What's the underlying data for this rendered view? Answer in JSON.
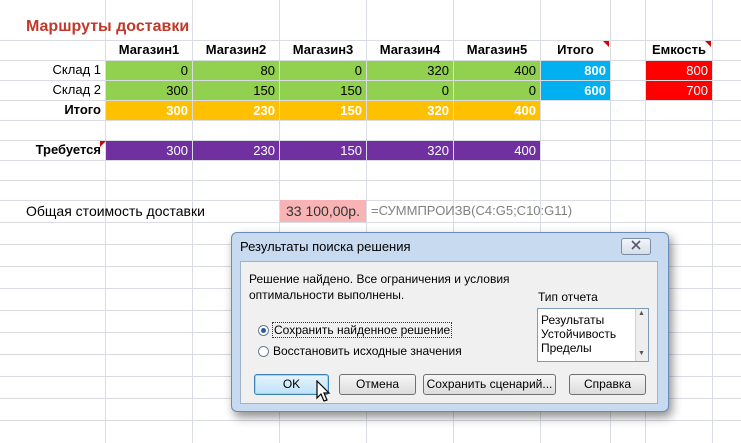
{
  "sheet": {
    "title": "Маршруты доставки",
    "col_headers": [
      "Магазин1",
      "Магазин2",
      "Магазин3",
      "Магазин4",
      "Магазин5"
    ],
    "total_header": "Итого",
    "capacity_header": "Емкость",
    "rows": [
      {
        "label": "Склад 1",
        "values": [
          "0",
          "80",
          "0",
          "320",
          "400"
        ],
        "total": "800",
        "capacity": "800"
      },
      {
        "label": "Склад 2",
        "values": [
          "300",
          "150",
          "150",
          "0",
          "0"
        ],
        "total": "600",
        "capacity": "700"
      }
    ],
    "totals_row": {
      "label": "Итого",
      "values": [
        "300",
        "230",
        "150",
        "320",
        "400"
      ]
    },
    "required_row": {
      "label": "Требуется",
      "values": [
        "300",
        "230",
        "150",
        "320",
        "400"
      ]
    },
    "cost_label": "Общая стоимость доставки",
    "cost_value": "33 100,00р.",
    "cost_formula": "=СУММПРОИЗВ(C4:G5;C10:G11)"
  },
  "colors": {
    "green": "#92d050",
    "orange": "#ffc000",
    "purple": "#7030a0",
    "blue": "#00b0f0",
    "red": "#ff0000",
    "pink": "#f8b4b4",
    "title": "#c0392b"
  },
  "dialog": {
    "title": "Результаты поиска решения",
    "close_icon": "close-icon",
    "message_line1": "Решение найдено. Все ограничения и условия",
    "message_line2": "оптимальности выполнены.",
    "report_type_label": "Тип отчета",
    "report_types": [
      "Результаты",
      "Устойчивость",
      "Пределы"
    ],
    "radio_keep": "Сохранить найденное решение",
    "radio_restore": "Восстановить исходные значения",
    "buttons": {
      "ok": "OK",
      "cancel": "Отмена",
      "save_scenario": "Сохранить сценарий...",
      "help": "Справка"
    }
  }
}
